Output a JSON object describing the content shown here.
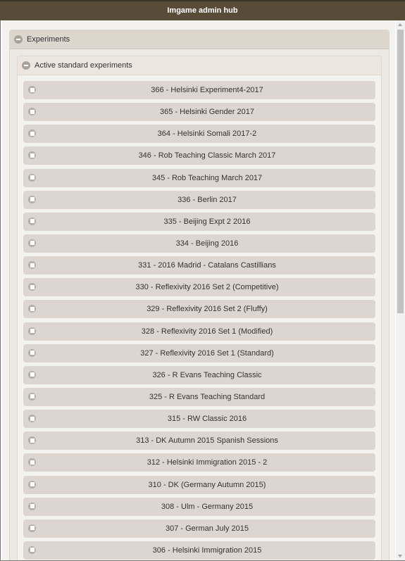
{
  "app": {
    "title": "Imgame admin hub"
  },
  "panels": {
    "experiments": {
      "title": "Experiments",
      "collapse_icon": "circle-minus-icon"
    },
    "active_standard": {
      "title": "Active standard experiments",
      "collapse_icon": "circle-minus-icon"
    }
  },
  "item_icon": "grid-icon",
  "experiments": [
    "366 - Helsinki Experiment4-2017",
    "365 - Helsinki Gender 2017",
    "364 - Helsinki Somali 2017-2",
    "346 - Rob Teaching Classic March 2017",
    "345 - Rob Teaching March 2017",
    "336 - Berlin 2017",
    "335 - Beijing Expt 2 2016",
    "334 - Beijing 2016",
    "331 - 2016 Madrid - Catalans Castillians",
    "330 - Reflexivity 2016 Set 2 (Competitive)",
    "329 - Reflexivity 2016 Set 2 (Fluffy)",
    "328 - Reflexivity 2016 Set 1 (Modified)",
    "327 - Reflexivity 2016 Set 1 (Standard)",
    "326 - R Evans Teaching Classic",
    "325 - R Evans Teaching Standard",
    "315 - RW Classic 2016",
    "313 - DK Autumn 2015 Spanish Sessions",
    "312 - Helsinki Immigration 2015 - 2",
    "310 - DK (Germany Autumn 2015)",
    "308 - Ulm - Germany 2015",
    "307 - German July 2015",
    "306 - Helsinki Immigration 2015"
  ],
  "colors": {
    "title_bar": "#584b38",
    "panel_header": "#ddd6cd",
    "item_background": "#ddd6d0",
    "text": "#333333"
  }
}
